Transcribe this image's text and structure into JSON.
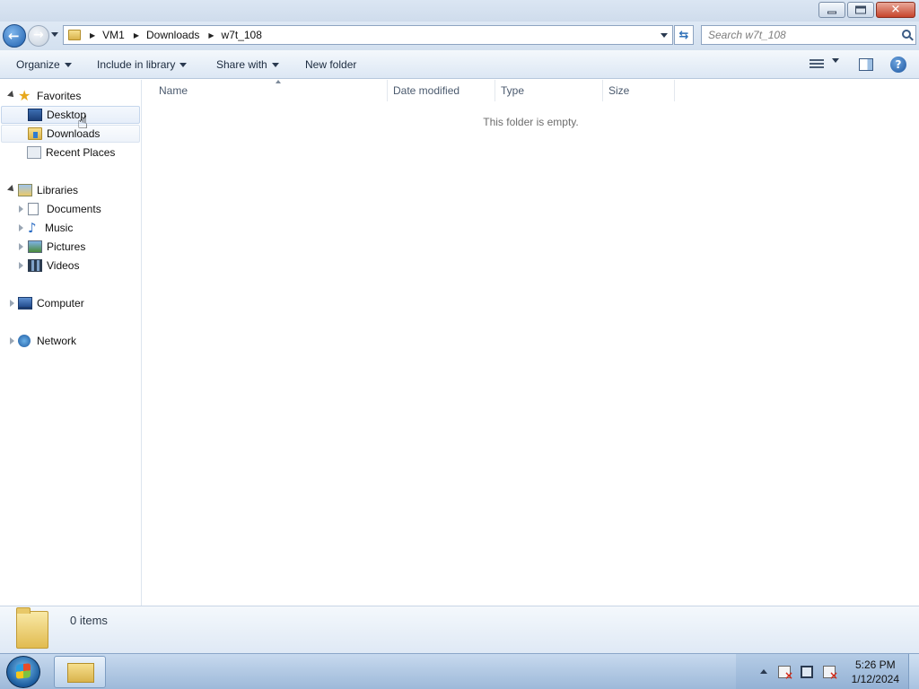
{
  "window": {
    "caption_buttons": [
      "minimize",
      "maximize",
      "close"
    ]
  },
  "address": {
    "breadcrumbs": [
      "VM1",
      "Downloads",
      "w7t_108"
    ],
    "search_placeholder": "Search w7t_108"
  },
  "toolbar": {
    "organize": "Organize",
    "include_in_library": "Include in library",
    "share_with": "Share with",
    "new_folder": "New folder"
  },
  "nav": {
    "favorites": "Favorites",
    "desktop": "Desktop",
    "downloads": "Downloads",
    "recent_places": "Recent Places",
    "libraries": "Libraries",
    "documents": "Documents",
    "music": "Music",
    "pictures": "Pictures",
    "videos": "Videos",
    "computer": "Computer",
    "network": "Network"
  },
  "columns": [
    "Name",
    "Date modified",
    "Type",
    "Size"
  ],
  "content": {
    "empty_message": "This folder is empty."
  },
  "details": {
    "item_count": "0 items"
  },
  "taskbar": {
    "time": "5:26 PM",
    "date": "1/12/2024"
  },
  "colors": {
    "accent": "#1e5fae",
    "selection": "#e6eef9",
    "taskbar": "#9db9d9"
  },
  "icons": {
    "back": "back-arrow-icon",
    "forward": "forward-arrow-icon",
    "search": "search-icon",
    "help": "help-icon"
  }
}
